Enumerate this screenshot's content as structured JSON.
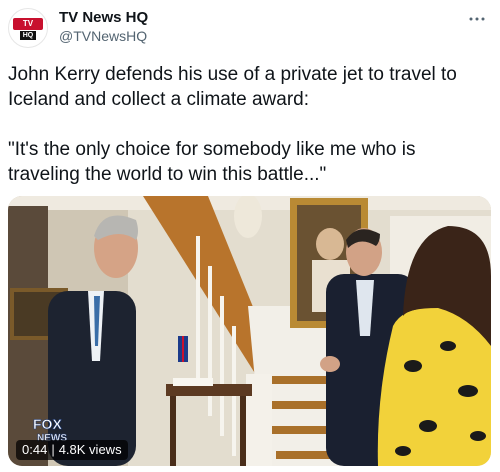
{
  "author": {
    "display_name": "TV News HQ",
    "handle": "@TVNewsHQ",
    "avatar": {
      "line1": "TV NEWS",
      "line2": "HQ"
    }
  },
  "menu": {
    "icon": "more-horizontal-icon"
  },
  "tweet": {
    "line1": "John Kerry defends his use of a private jet to travel to Iceland and collect a climate award:",
    "line2": "\"It's the only choice for somebody like me who is traveling the world to win this battle...\""
  },
  "video": {
    "time": "0:44",
    "views": "4.8K views",
    "watermark": "FOX NEWS"
  },
  "colors": {
    "text": "#0f1419",
    "secondary": "#536471",
    "brand_red": "#c8102e"
  }
}
